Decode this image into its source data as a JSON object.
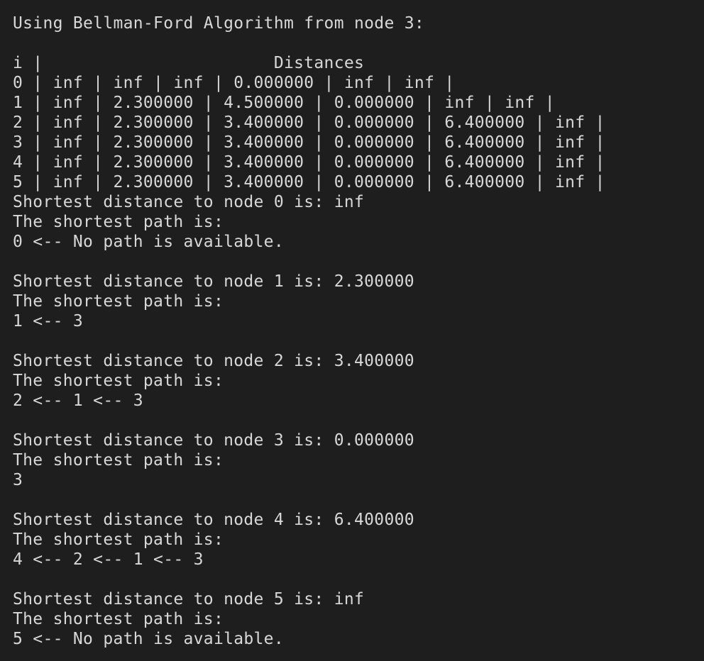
{
  "terminal": {
    "lines": [
      "Using Bellman-Ford Algorithm from node 3:",
      "",
      "i |                       Distances",
      "0 | inf | inf | inf | 0.000000 | inf | inf |",
      "1 | inf | 2.300000 | 4.500000 | 0.000000 | inf | inf |",
      "2 | inf | 2.300000 | 3.400000 | 0.000000 | 6.400000 | inf |",
      "3 | inf | 2.300000 | 3.400000 | 0.000000 | 6.400000 | inf |",
      "4 | inf | 2.300000 | 3.400000 | 0.000000 | 6.400000 | inf |",
      "5 | inf | 2.300000 | 3.400000 | 0.000000 | 6.400000 | inf |",
      "Shortest distance to node 0 is: inf",
      "The shortest path is:",
      "0 <-- No path is available.",
      "",
      "Shortest distance to node 1 is: 2.300000",
      "The shortest path is:",
      "1 <-- 3",
      "",
      "Shortest distance to node 2 is: 3.400000",
      "The shortest path is:",
      "2 <-- 1 <-- 3",
      "",
      "Shortest distance to node 3 is: 0.000000",
      "The shortest path is:",
      "3",
      "",
      "Shortest distance to node 4 is: 6.400000",
      "The shortest path is:",
      "4 <-- 2 <-- 1 <-- 3",
      "",
      "Shortest distance to node 5 is: inf",
      "The shortest path is:",
      "5 <-- No path is available."
    ]
  }
}
